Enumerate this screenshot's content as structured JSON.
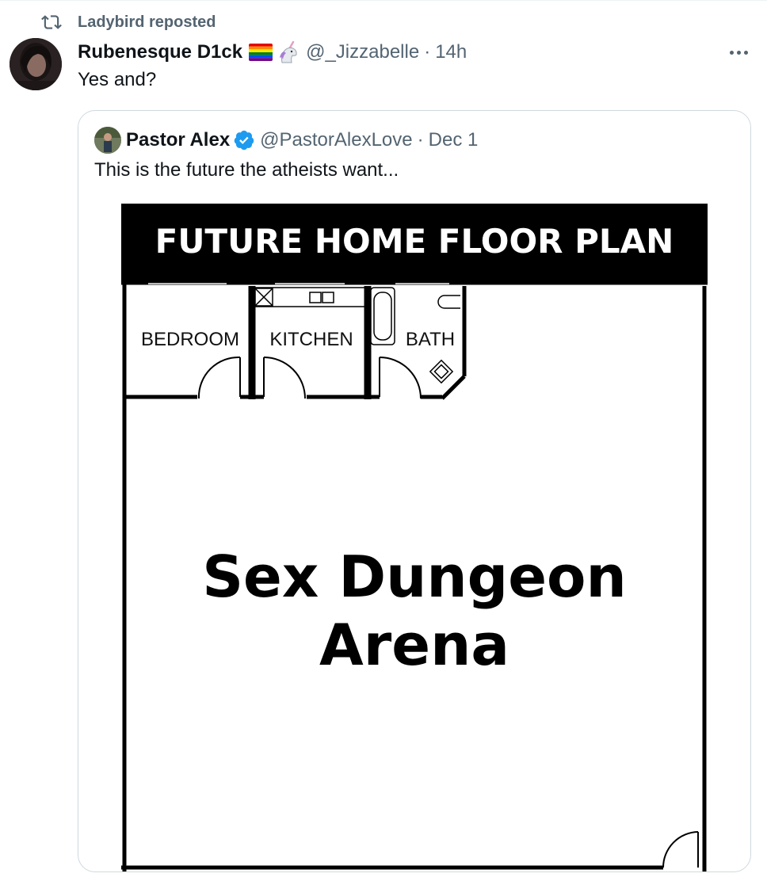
{
  "repost": {
    "label": "Ladybird reposted",
    "icon": "repost-icon"
  },
  "tweet": {
    "author_name": "Rubenesque D1ck",
    "emoji_icons": [
      "rainbow-flag-icon",
      "unicorn-icon"
    ],
    "handle": "@_Jizzabelle",
    "separator": "·",
    "time": "14h",
    "text": "Yes and?",
    "more_icon": "more-icon"
  },
  "quote": {
    "author_name": "Pastor Alex",
    "verified_icon": "verified-badge-icon",
    "handle": "@PastorAlexLove",
    "separator": "·",
    "date": "Dec 1",
    "text": "This is the future the atheists want...",
    "image": {
      "title": "FUTURE HOME FLOOR PLAN",
      "rooms": [
        "BEDROOM",
        "KITCHEN",
        "BATH"
      ],
      "main_room_line1": "Sex Dungeon",
      "main_room_line2": "Arena"
    }
  },
  "colors": {
    "text": "#0f1419",
    "muted": "#536471",
    "border": "#cfd9de",
    "verified": "#1d9bf0"
  }
}
